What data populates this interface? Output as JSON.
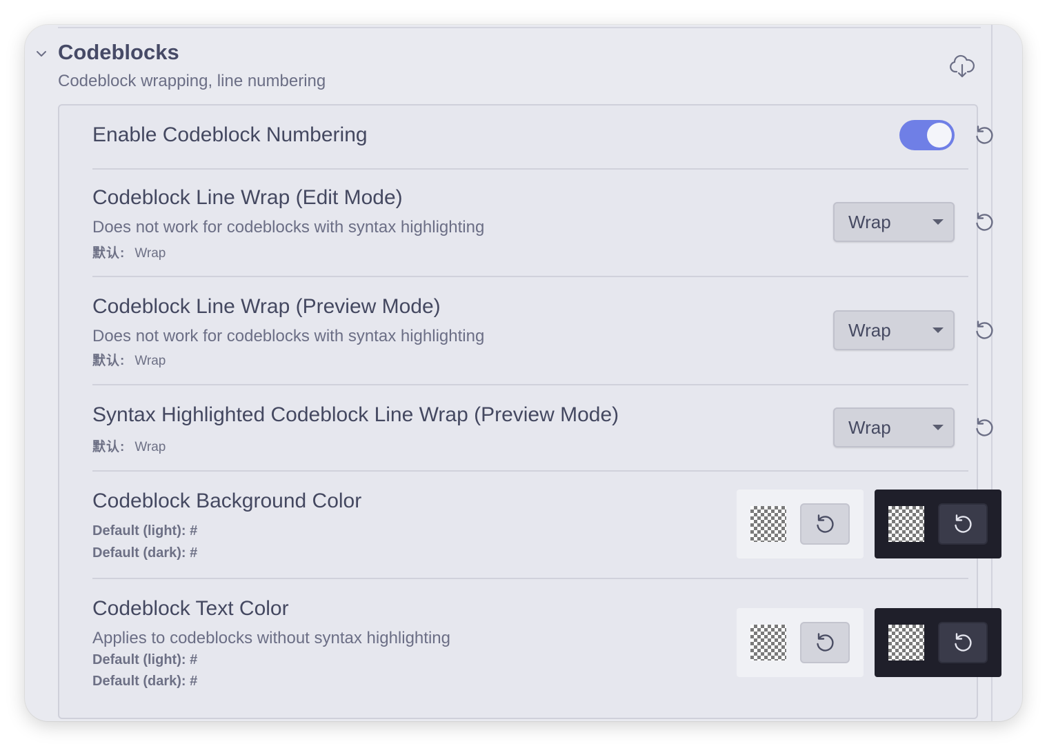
{
  "section": {
    "title": "Codeblocks",
    "description": "Codeblock wrapping, line numbering"
  },
  "settings": {
    "numbering": {
      "name": "Enable Codeblock Numbering",
      "enabled": true
    },
    "wrap_edit": {
      "name": "Codeblock Line Wrap (Edit Mode)",
      "description": "Does not work for codeblocks with syntax highlighting",
      "default_label": "默认:",
      "default_value": "Wrap",
      "selected": "Wrap"
    },
    "wrap_preview": {
      "name": "Codeblock Line Wrap (Preview Mode)",
      "description": "Does not work for codeblocks with syntax highlighting",
      "default_label": "默认:",
      "default_value": "Wrap",
      "selected": "Wrap"
    },
    "wrap_syntax": {
      "name": "Syntax Highlighted Codeblock Line Wrap (Preview Mode)",
      "default_label": "默认:",
      "default_value": "Wrap",
      "selected": "Wrap"
    },
    "bg_color": {
      "name": "Codeblock Background Color",
      "default_light": "Default (light): #",
      "default_dark": "Default (dark): #"
    },
    "text_color": {
      "name": "Codeblock Text Color",
      "description": "Applies to codeblocks without syntax highlighting",
      "default_light": "Default (light): #",
      "default_dark": "Default (dark): #"
    }
  },
  "colors": {
    "accent": "#6f7fe6",
    "background": "#e9eaf0",
    "dark_swatch_bg": "#1f1f2a"
  },
  "icons": [
    "chevron-down-icon",
    "cloud-download-icon",
    "reset-icon",
    "dropdown-caret-icon",
    "transparent-checker-icon"
  ]
}
